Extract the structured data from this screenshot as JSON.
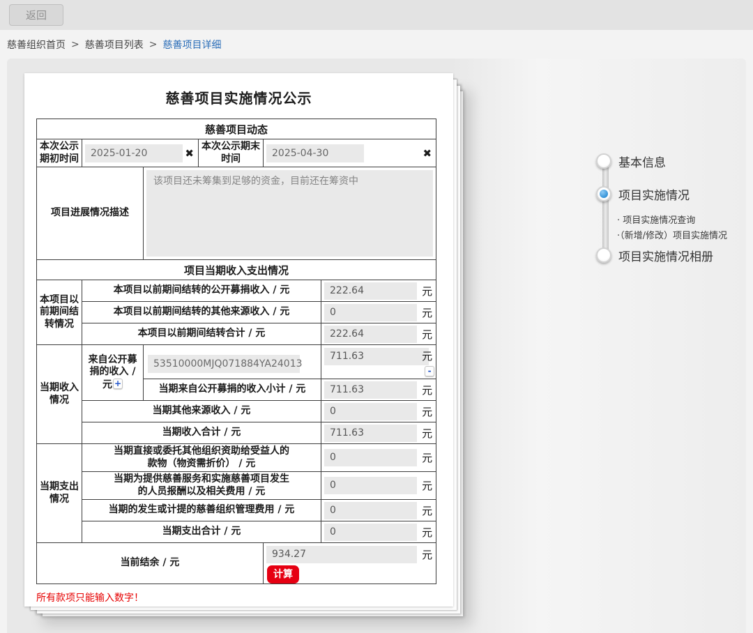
{
  "colors": {
    "breadcrumb_current_blue": "#2a6db8",
    "calc_button_red": "#e60012",
    "error_red": "#e60000",
    "active_step_blue": "#2f8fd6"
  },
  "topbar": {
    "back_label": "返回"
  },
  "breadcrumb": {
    "separator": ">",
    "items": [
      "慈善组织首页",
      "慈善项目列表",
      "慈善项目详细"
    ]
  },
  "form": {
    "title": "慈善项目实施情况公示",
    "dynamics_header": "慈善项目动态",
    "period_start": {
      "label": "本次公示期初时间",
      "value": "2025-01-20",
      "clear_icon": "✖"
    },
    "period_end": {
      "label": "本次公示期末时间",
      "value": "2025-04-30",
      "clear_icon": "✖"
    },
    "progress": {
      "label": "项目进展情况描述",
      "value": "该项目还未筹集到足够的资金，目前还在筹资中"
    },
    "finance_header": "项目当期收入支出情况",
    "unit": "元",
    "carryover": {
      "group_label": "本项目以前期间结转情况",
      "rows": [
        {
          "label": "本项目以前期间结转的公开募捐收入 / 元",
          "value": "222.64"
        },
        {
          "label": "本项目以前期间结转的其他来源收入 / 元",
          "value": "0"
        },
        {
          "label": "本项目以前期间结转合计 / 元",
          "value": "222.64"
        }
      ]
    },
    "income": {
      "group_label": "当期收入情况",
      "public_label": "来自公开募捐的收入 / 元",
      "add_label": "+",
      "remove_label": "-",
      "account_value": "53510000MJQ071884YA24013",
      "account_amount": "711.63",
      "rows": [
        {
          "label": "当期来自公开募捐的收入小计 / 元",
          "value": "711.63"
        },
        {
          "label": "当期其他来源收入 / 元",
          "value": "0"
        },
        {
          "label": "当期收入合计 / 元",
          "value": "711.63"
        }
      ]
    },
    "expense": {
      "group_label": "当期支出情况",
      "rows": [
        {
          "label": "当期直接或委托其他组织资助给受益人的款物（物资需折价） / 元",
          "value": "0"
        },
        {
          "label": "当期为提供慈善服务和实施慈善项目发生的人员报酬以及相关费用 / 元",
          "value": "0"
        },
        {
          "label": "当期的发生或计提的慈善组织管理费用 / 元",
          "value": "0"
        },
        {
          "label": "当期支出合计 / 元",
          "value": "0"
        }
      ]
    },
    "balance": {
      "label": "当前结余 / 元",
      "value": "934.27",
      "calc_label": "计算"
    },
    "footnote": "所有款项只能输入数字！"
  },
  "stepper": {
    "items": [
      {
        "label": "基本信息",
        "active": false
      },
      {
        "label": "项目实施情况",
        "active": true
      },
      {
        "label": "项目实施情况相册",
        "active": false
      }
    ],
    "sub_items": [
      {
        "label": "· 项目实施情况查询"
      },
      {
        "label": "·（新增/修改）项目实施情况"
      }
    ]
  }
}
